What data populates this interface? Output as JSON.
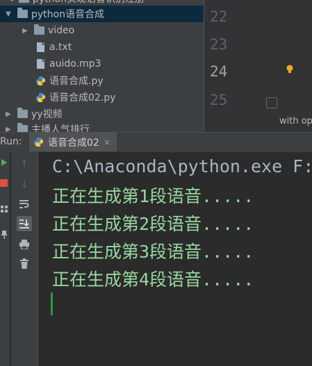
{
  "project_tree": {
    "items": [
      {
        "label": "python实现语音识别注册",
        "type": "folder"
      },
      {
        "label": "python语音合成",
        "type": "folder",
        "expanded": true,
        "selected": true
      },
      {
        "label": "video",
        "type": "folder"
      },
      {
        "label": "a.txt",
        "type": "file"
      },
      {
        "label": "auido.mp3",
        "type": "file"
      },
      {
        "label": "语音合成.py",
        "type": "python"
      },
      {
        "label": "语音合成02.py",
        "type": "python"
      },
      {
        "label": "yy视频",
        "type": "folder"
      },
      {
        "label": "主播人气排行",
        "type": "folder"
      }
    ]
  },
  "editor": {
    "lines": [
      "22",
      "23",
      "24",
      "25"
    ],
    "current_line": "24",
    "hint_text": "with op",
    "icons": {
      "intention": "lightbulb-icon",
      "fold": "fold-icon"
    }
  },
  "run_panel": {
    "label": "Run:",
    "tab": {
      "label": "语音合成02",
      "close": "×"
    },
    "toolbar_left": [
      "rerun-icon",
      "stop-icon",
      "layout-icon",
      "pin-icon"
    ],
    "toolbar": [
      "up-arrow-icon",
      "down-arrow-icon",
      "soft-wrap-icon",
      "scroll-to-end-icon",
      "print-icon",
      "trash-icon"
    ]
  },
  "console": {
    "command": "C:\\Anaconda\\python.exe F:/",
    "output": [
      "正在生成第1段语音.....",
      "正在生成第2段语音.....",
      "正在生成第3段语音.....",
      "正在生成第4段语音....."
    ]
  },
  "colors": {
    "output": "#97d7a0",
    "command": "#a9b7c6",
    "selection": "#0d293e",
    "caret": "#2d9a3a"
  }
}
